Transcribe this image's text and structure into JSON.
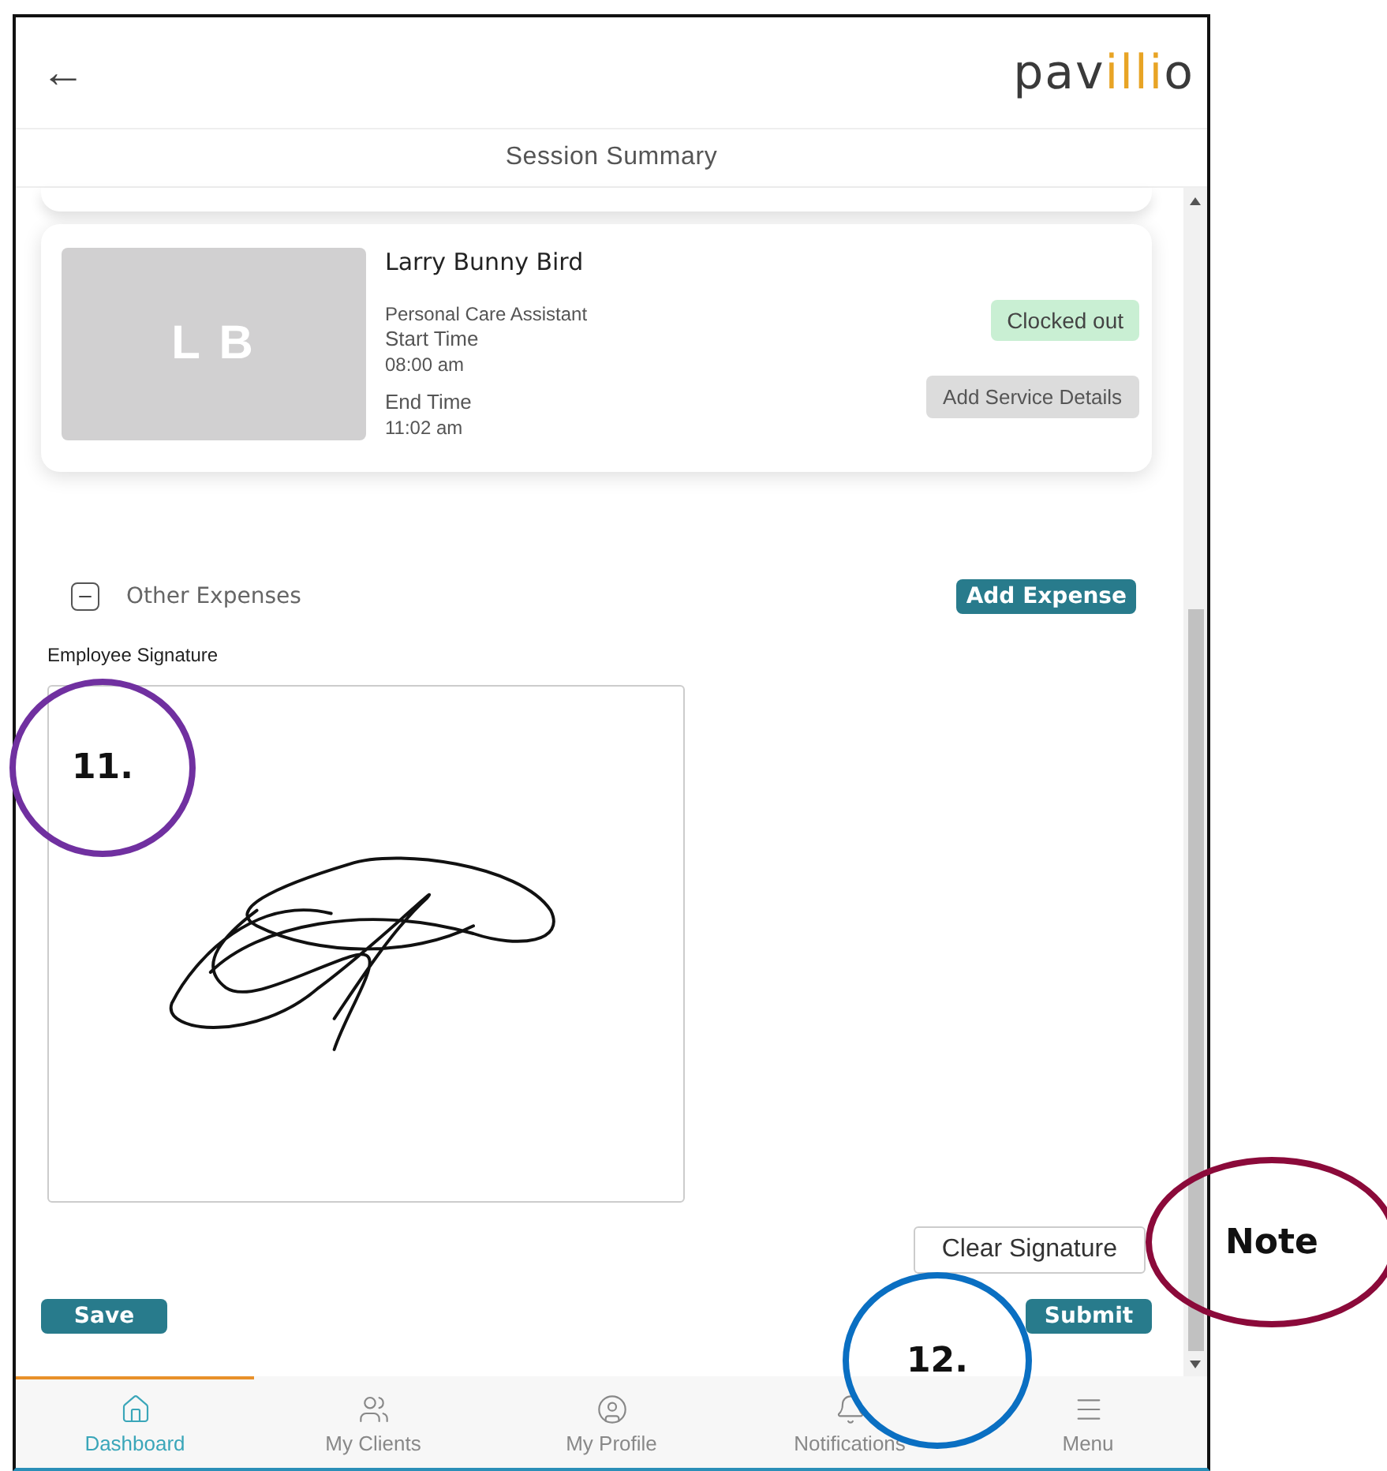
{
  "header": {
    "back": "←",
    "logo": {
      "lead": "pav",
      "accent": "illi",
      "tail": "o"
    }
  },
  "title": "Session Summary",
  "session_card": {
    "initials": "L B",
    "name": "Larry Bunny Bird",
    "role": "Personal Care Assistant",
    "start_label": "Start Time",
    "start_time": "08:00 am",
    "end_label": "End Time",
    "end_time": "11:02 am",
    "status": "Clocked out",
    "action": "Add Service Details"
  },
  "expenses": {
    "label": "Other Expenses",
    "expanded": true,
    "button": "Add Expense"
  },
  "signature": {
    "label": "Employee Signature",
    "signed": true,
    "clear_button": "Clear Signature"
  },
  "buttons": {
    "save": "Save",
    "submit": "Submit"
  },
  "nav": [
    {
      "label": "Dashboard",
      "selected": true
    },
    {
      "label": "My Clients",
      "selected": false
    },
    {
      "label": "My Profile",
      "selected": false
    },
    {
      "label": "Notifications",
      "selected": false
    },
    {
      "label": "Menu",
      "selected": false
    }
  ],
  "annotations": [
    {
      "label": "11.",
      "color": "#7030a0"
    },
    {
      "label": "Note",
      "color": "#8b0a3a"
    },
    {
      "label": "12.",
      "color": "#0a6fc2"
    }
  ]
}
